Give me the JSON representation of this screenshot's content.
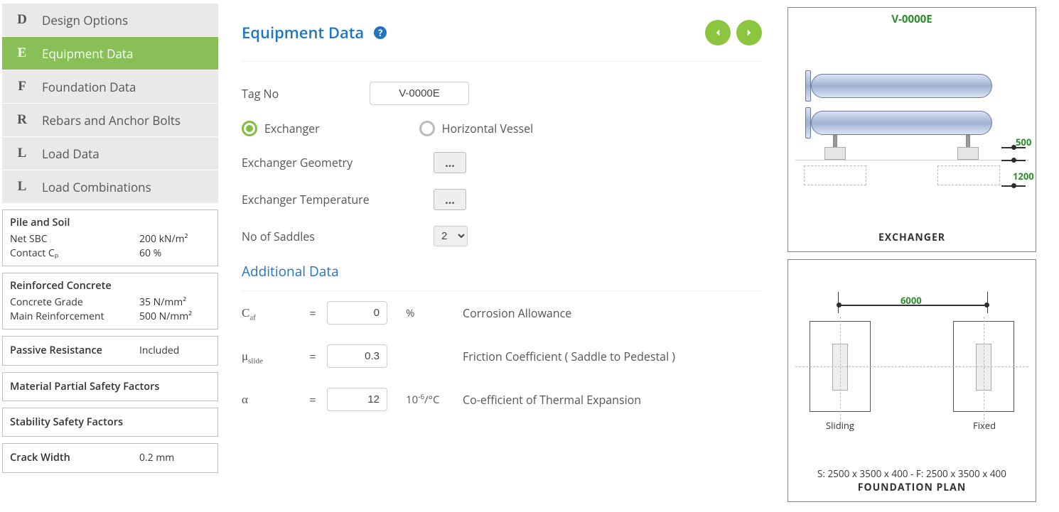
{
  "nav": [
    {
      "key": "D",
      "label": "Design Options",
      "active": false
    },
    {
      "key": "E",
      "label": "Equipment Data",
      "active": true
    },
    {
      "key": "F",
      "label": "Foundation Data",
      "active": false
    },
    {
      "key": "R",
      "label": "Rebars and Anchor Bolts",
      "active": false
    },
    {
      "key": "L",
      "label": "Load Data",
      "active": false
    },
    {
      "key": "L",
      "label": "Load Combinations",
      "active": false
    }
  ],
  "cards": {
    "pile": {
      "title": "Pile and Soil",
      "rows": [
        {
          "label": "Net SBC",
          "value": "200 kN/m²"
        },
        {
          "label": "Contact Cₚ",
          "value": "60 %"
        }
      ]
    },
    "concrete": {
      "title": "Reinforced Concrete",
      "rows": [
        {
          "label": "Concrete Grade",
          "value": "35 N/mm²"
        },
        {
          "label": "Main Reinforcement",
          "value": "500 N/mm²"
        }
      ]
    },
    "passive": {
      "title": "Passive Resistance",
      "value": "Included"
    },
    "mpsf": {
      "title": "Material Partial Safety Factors"
    },
    "ssf": {
      "title": "Stability Safety Factors"
    },
    "crack": {
      "title": "Crack Width",
      "value": "0.2 mm"
    }
  },
  "page": {
    "title": "Equipment Data",
    "help": "?",
    "prev_icon": "◀",
    "next_icon": "▶"
  },
  "form": {
    "tag_label": "Tag No",
    "tag_value": "V-0000E",
    "eq_type": {
      "exchanger": "Exchanger",
      "horizontal": "Horizontal Vessel",
      "selected": "exchanger"
    },
    "geom_label": "Exchanger Geometry",
    "temp_label": "Exchanger Temperature",
    "ellipsis": "...",
    "saddles_label": "No of Saddles",
    "saddles_value": "2"
  },
  "additional": {
    "title": "Additional Data",
    "rows": [
      {
        "sym": "C",
        "sub": "af",
        "eq": "=",
        "val": "0",
        "unit": "%",
        "desc": "Corrosion Allowance"
      },
      {
        "sym": "μ",
        "sub": "slide",
        "eq": "=",
        "val": "0.3",
        "unit": "",
        "desc": "Friction Coefficient ( Saddle to Pedestal )"
      },
      {
        "sym": "α",
        "sub": "",
        "eq": "=",
        "val": "12",
        "unit": "10⁻⁶/°C",
        "desc": "Co-efficient of Thermal Expansion"
      }
    ]
  },
  "diag1": {
    "tag": "V-0000E",
    "caption": "EXCHANGER",
    "dim1": "500",
    "dim2": "1200"
  },
  "diag2": {
    "dim_span": "6000",
    "sliding": "Sliding",
    "fixed": "Fixed",
    "dims_text": "S: 2500 x 3500 x 400 - F: 2500 x 3500 x 400",
    "caption": "FOUNDATION PLAN"
  }
}
